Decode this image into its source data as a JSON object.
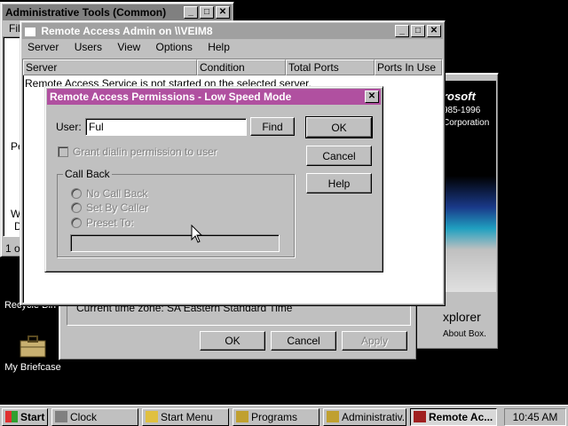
{
  "colors": {
    "desktop": "#000000",
    "dialog_title": "#b050a0",
    "window_face": "#c0c0c0"
  },
  "admin_tools": {
    "title": "Administrative Tools (Common)",
    "menu_partial": "File",
    "side_texts": [
      "Pe",
      "W",
      "D"
    ],
    "status_partial": "1 o"
  },
  "ras_admin": {
    "title": "Remote Access Admin on \\\\VEIM8",
    "menu": [
      "Server",
      "Users",
      "View",
      "Options",
      "Help"
    ],
    "columns": [
      "Server",
      "Condition",
      "Total Ports",
      "Ports In Use"
    ],
    "row_text": "Remote Access Service is not started on the selected server."
  },
  "back_window": {
    "ms_logo": "rosoft",
    "years": "985-1996",
    "corp": "Corporation",
    "explorer": "xplorer",
    "about": "About Box."
  },
  "datetime_dialog": {
    "timezone_text": "Current time zone:  SA Eastern Standard Time",
    "ok_label": "OK",
    "cancel_label": "Cancel",
    "apply_label": "Apply"
  },
  "permissions": {
    "title": "Remote Access Permissions - Low Speed Mode",
    "user_label": "User:",
    "user_value": "Ful",
    "find_label": "Find",
    "ok_label": "OK",
    "cancel_label": "Cancel",
    "help_label": "Help",
    "grant_label": "Grant dialin permission to user",
    "callback_group": "Call Back",
    "radio_no": "No Call Back",
    "radio_caller": "Set By Caller",
    "radio_preset": "Preset To:"
  },
  "desktop_icons": {
    "recycle": "Recycle Bin",
    "briefcase": "My Briefcase"
  },
  "taskbar": {
    "start": "Start",
    "items": [
      "Clock",
      "Start Menu",
      "Programs",
      "Administrativ...",
      "Remote Ac..."
    ],
    "clock": "10:45 AM"
  }
}
